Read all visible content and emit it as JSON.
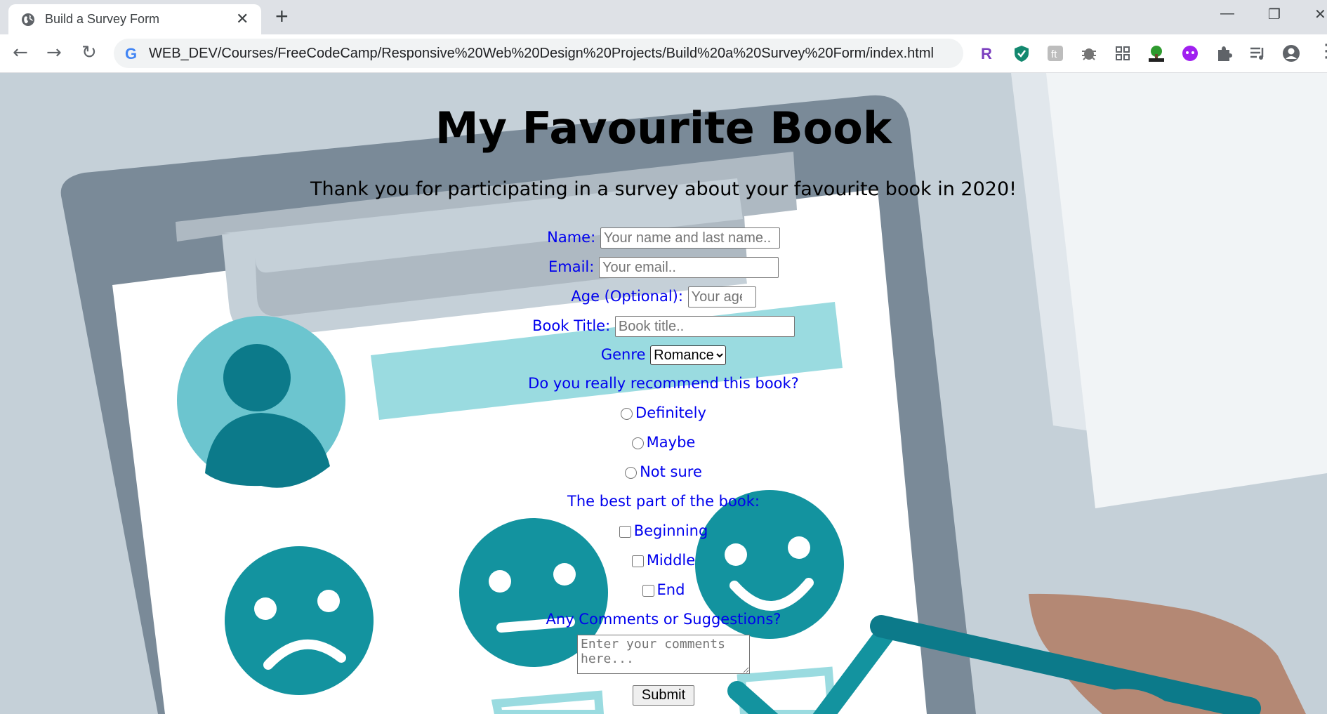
{
  "browser": {
    "tab_title": "Build a Survey Form",
    "tab_close": "✕",
    "new_tab": "+",
    "url": "WEB_DEV/Courses/FreeCodeCamp/Responsive%20Web%20Design%20Projects/Build%20a%20Survey%20Form/index.html",
    "nav": {
      "back": "←",
      "forward": "→",
      "reload": "↻"
    },
    "window": {
      "minimize": "—",
      "restore": "❐",
      "close": "✕"
    }
  },
  "survey": {
    "title": "My Favourite Book",
    "description": "Thank you for participating in a survey about your favourite book in 2020!",
    "name_label": "Name:",
    "name_placeholder": "Your name and last name..",
    "email_label": "Email:",
    "email_placeholder": "Your email..",
    "age_label": "Age (Optional):",
    "age_placeholder": "Your age",
    "book_label": "Book Title:",
    "book_placeholder": "Book title..",
    "genre_label": "Genre",
    "genre_selected": "Romance",
    "recommend_question": "Do you really recommend this book?",
    "recommend_options": [
      "Definitely",
      "Maybe",
      "Not sure"
    ],
    "best_part_question": "The best part of the book:",
    "best_part_options": [
      "Beginning",
      "Middle",
      "End"
    ],
    "comments_label": "Any Comments or Suggestions?",
    "comments_placeholder": "Enter your comments here...",
    "submit_label": "Submit"
  },
  "colors": {
    "background": "#c5d0d8",
    "clipboard": "#7a8a98",
    "teal": "#13939f",
    "light_teal": "#9adbe0",
    "label_blue": "#0000ee"
  }
}
